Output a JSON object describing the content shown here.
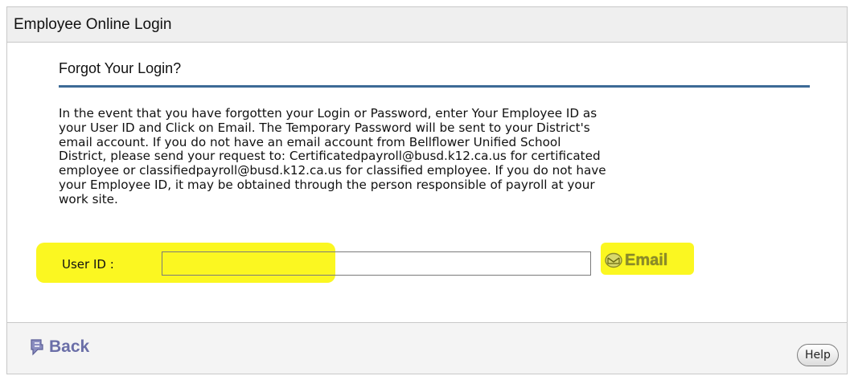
{
  "window": {
    "title": "Employee Online Login"
  },
  "section": {
    "heading": "Forgot Your Login?"
  },
  "instructions": {
    "lines": [
      "In the event that you have forgotten your Login or Password, enter Your Employee ID as",
      "your User ID and Click on Email. The Temporary Password will be sent to your District's",
      "email account. If you do not have an email account from Bellflower Unified School",
      "District, please send your request to: Certificatedpayroll@busd.k12.ca.us for certificated",
      "employee or classifiedpayroll@busd.k12.ca.us for classified employee. If you do not have",
      "your Employee ID, it may be obtained through the person responsible of payroll at your",
      "work site."
    ]
  },
  "form": {
    "user_id_label": "User ID :",
    "user_id_value": "",
    "email_button_label": "Email",
    "email_icon": "envelope-icon"
  },
  "footer": {
    "back_label": "Back",
    "back_icon": "back-arrow-icon",
    "help_label": "Help"
  },
  "colors": {
    "accent_rule": "#3c6a96",
    "highlight": "#fbf721",
    "back_link": "#6b6fa8",
    "email_text": "#8a8a2a"
  }
}
